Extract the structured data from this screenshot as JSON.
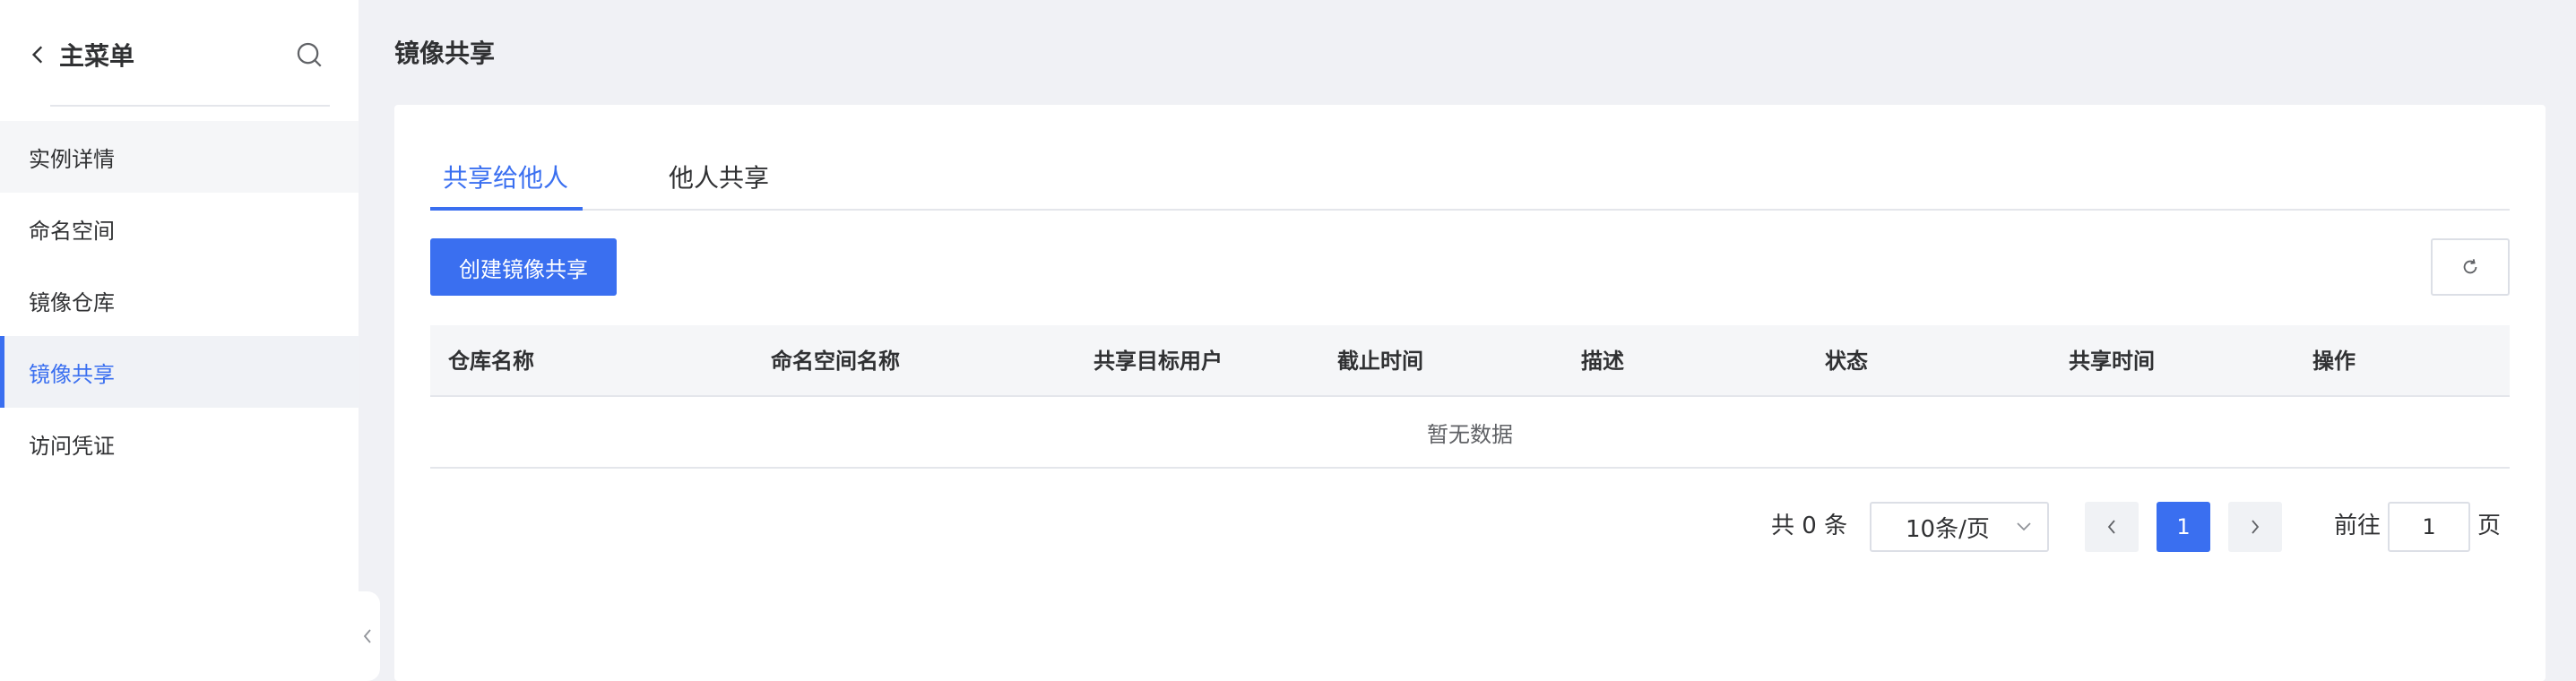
{
  "sidebar": {
    "title": "主菜单",
    "items": [
      {
        "label": "实例详情"
      },
      {
        "label": "命名空间"
      },
      {
        "label": "镜像仓库"
      },
      {
        "label": "镜像共享"
      },
      {
        "label": "访问凭证"
      }
    ],
    "active_index": 3
  },
  "page": {
    "title": "镜像共享"
  },
  "tabs": [
    {
      "label": "共享给他人",
      "active": true
    },
    {
      "label": "他人共享",
      "active": false
    }
  ],
  "toolbar": {
    "create_label": "创建镜像共享"
  },
  "table": {
    "columns": [
      "仓库名称",
      "命名空间名称",
      "共享目标用户",
      "截止时间",
      "描述",
      "状态",
      "共享时间",
      "操作"
    ],
    "rows": [],
    "empty_text": "暂无数据"
  },
  "pagination": {
    "total_text": "共 0 条",
    "page_size": "10条/页",
    "current_page": "1",
    "goto_prefix": "前往",
    "goto_suffix": "页",
    "goto_value": "1"
  },
  "colors": {
    "accent": "#3a6ff0",
    "background": "#f0f1f5"
  }
}
